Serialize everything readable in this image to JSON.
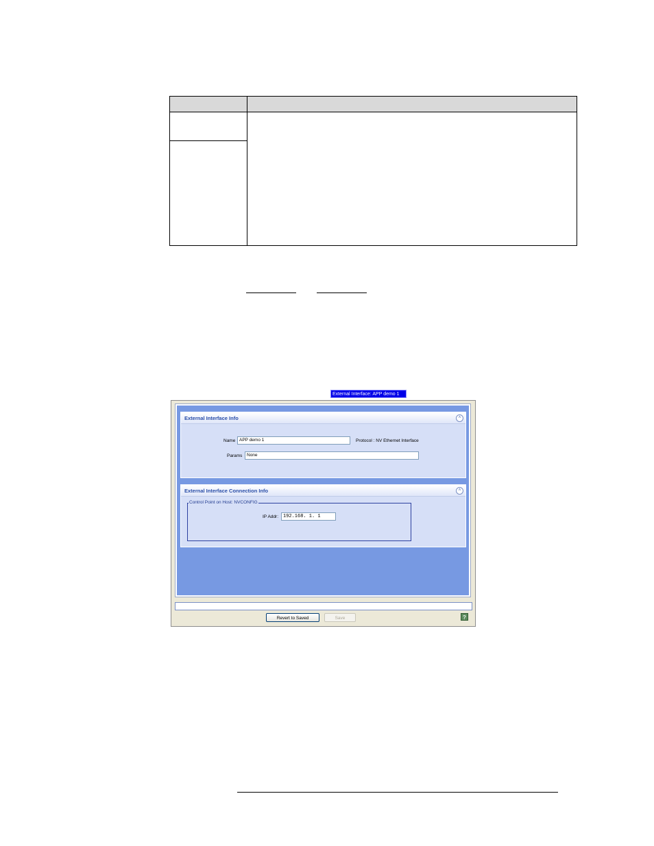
{
  "window": {
    "tab_title": "External Interface: APP demo 1",
    "info_panel": {
      "title": "External Interface Info",
      "name_label": "Name",
      "name_value": "APP demo 1",
      "protocol_text": "Protocol : NV Ethernet Interface",
      "params_label": "Params",
      "params_value": "None",
      "collapse_glyph": "˄"
    },
    "connection_panel": {
      "title": "External Interface Connection Info",
      "group_legend": "Control Point on Host: NVCONFIG",
      "ip_label": "IP Addr:",
      "ip_value": "192.168.  1.  1",
      "collapse_glyph": "˄"
    },
    "buttons": {
      "revert": "Revert to Saved",
      "save": "Save"
    },
    "help_glyph": "?"
  },
  "colors": {
    "tab_blue": "#0000e8",
    "workspace_blue": "#7799e2",
    "panel_bg": "#d6dff7",
    "title_text": "#2a4ea8"
  }
}
